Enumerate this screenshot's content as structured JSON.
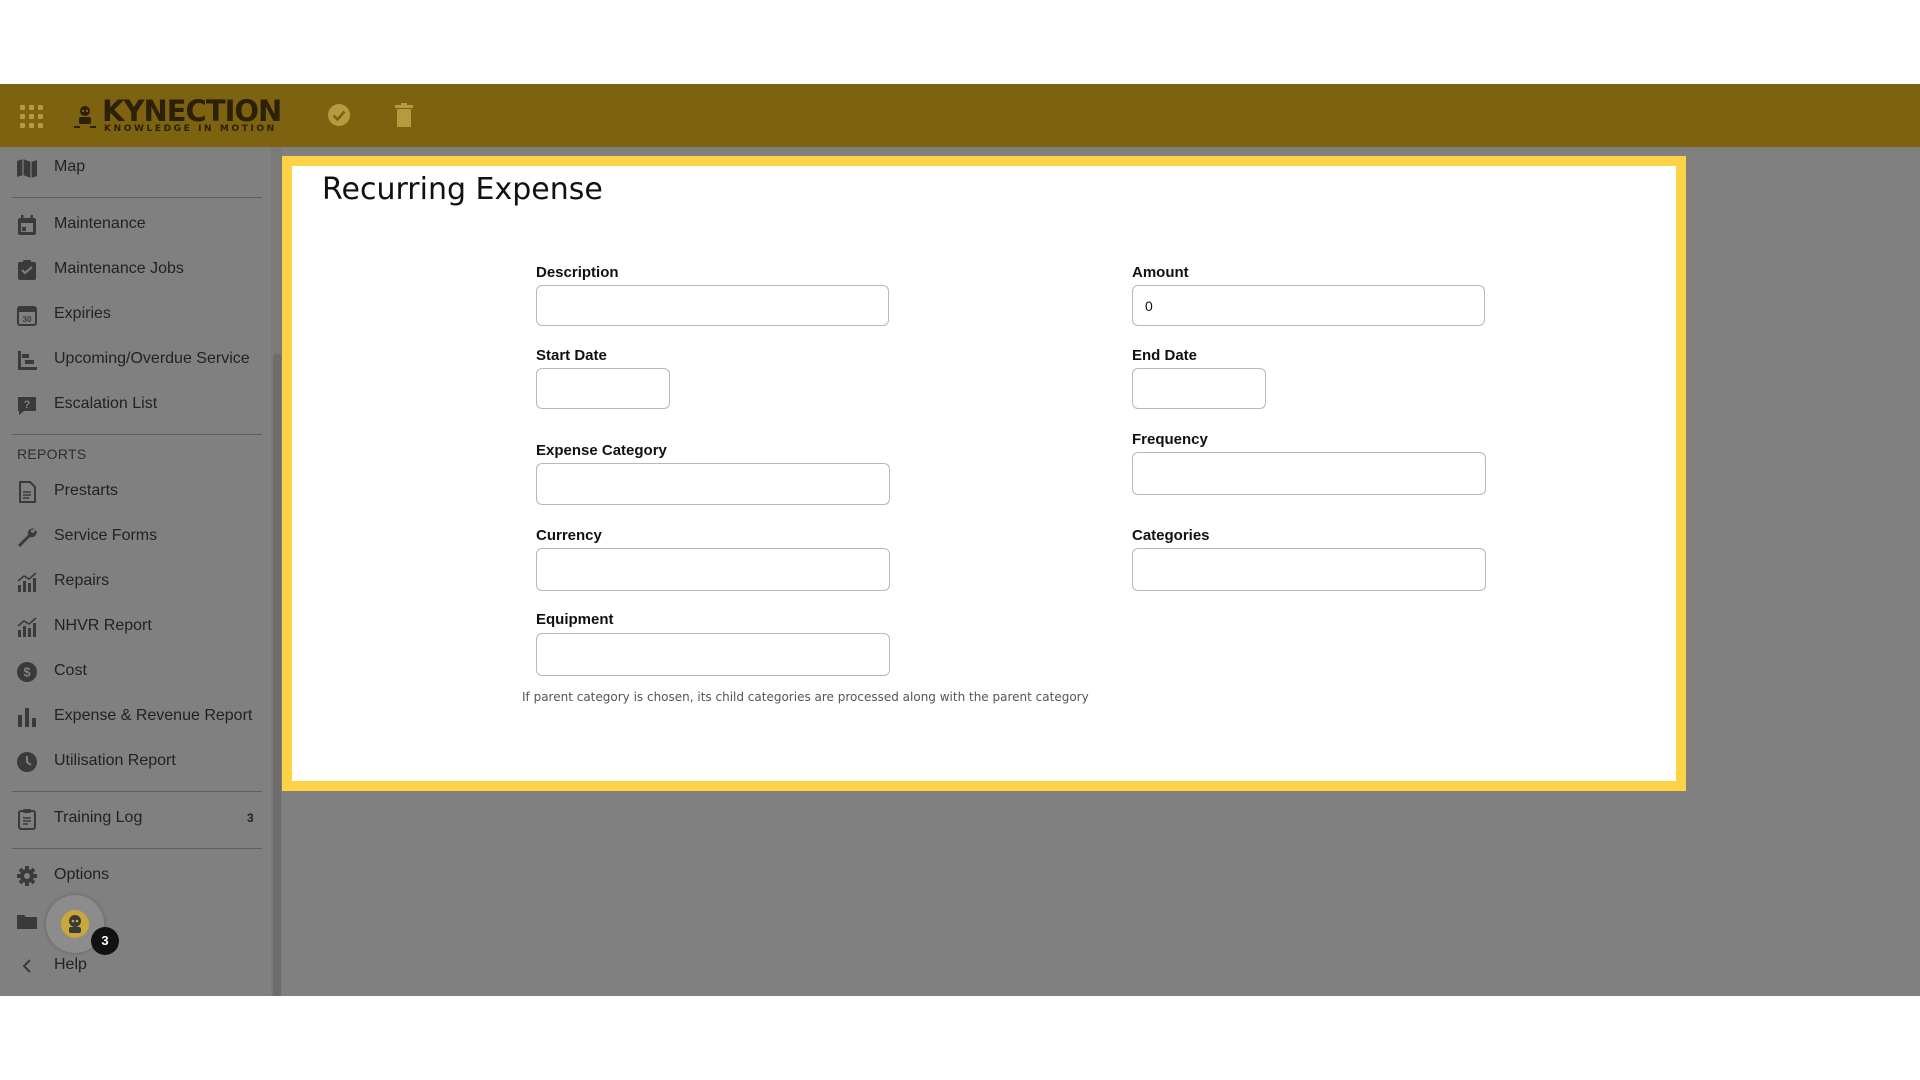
{
  "brand": {
    "name": "KYNECTION",
    "tagline": "KNOWLEDGE IN MOTION"
  },
  "colors": {
    "topbar": "#7d620f",
    "highlight": "#fdd244",
    "overlay": "#808080"
  },
  "toolbar": {
    "save_icon": "check-circle-icon",
    "delete_icon": "trash-icon"
  },
  "sidebar": {
    "items": [
      {
        "label": "Map",
        "icon": "map-icon"
      },
      {
        "label": "Maintenance",
        "icon": "calendar-icon"
      },
      {
        "label": "Maintenance Jobs",
        "icon": "clipboard-check-icon"
      },
      {
        "label": "Expiries",
        "icon": "calendar-30-icon"
      },
      {
        "label": "Upcoming/Overdue Service",
        "icon": "timeline-icon"
      },
      {
        "label": "Escalation List",
        "icon": "question-box-icon"
      }
    ],
    "reports_header": "REPORTS",
    "reports": [
      {
        "label": "Prestarts",
        "icon": "document-icon"
      },
      {
        "label": "Service Forms",
        "icon": "wrench-icon"
      },
      {
        "label": "Repairs",
        "icon": "chart-icon"
      },
      {
        "label": "NHVR Report",
        "icon": "chart-icon"
      },
      {
        "label": "Cost",
        "icon": "dollar-icon"
      },
      {
        "label": "Expense & Revenue Report",
        "icon": "bar-chart-icon"
      },
      {
        "label": "Utilisation Report",
        "icon": "clock-icon"
      }
    ],
    "training": {
      "label": "Training Log",
      "count": "3"
    },
    "options": {
      "label": "Options"
    },
    "help": {
      "label": "Help"
    },
    "avatar_badge": "3"
  },
  "form": {
    "title": "Recurring Expense",
    "description": {
      "label": "Description",
      "value": ""
    },
    "amount": {
      "label": "Amount",
      "value": "0"
    },
    "start_date": {
      "label": "Start Date",
      "value": ""
    },
    "end_date": {
      "label": "End Date",
      "value": ""
    },
    "expense_category": {
      "label": "Expense Category",
      "value": ""
    },
    "frequency": {
      "label": "Frequency",
      "value": ""
    },
    "currency": {
      "label": "Currency",
      "value": ""
    },
    "categories": {
      "label": "Categories",
      "value": ""
    },
    "equipment": {
      "label": "Equipment",
      "value": ""
    },
    "hint": "If parent category is chosen, its child categories are processed along with the parent category"
  }
}
